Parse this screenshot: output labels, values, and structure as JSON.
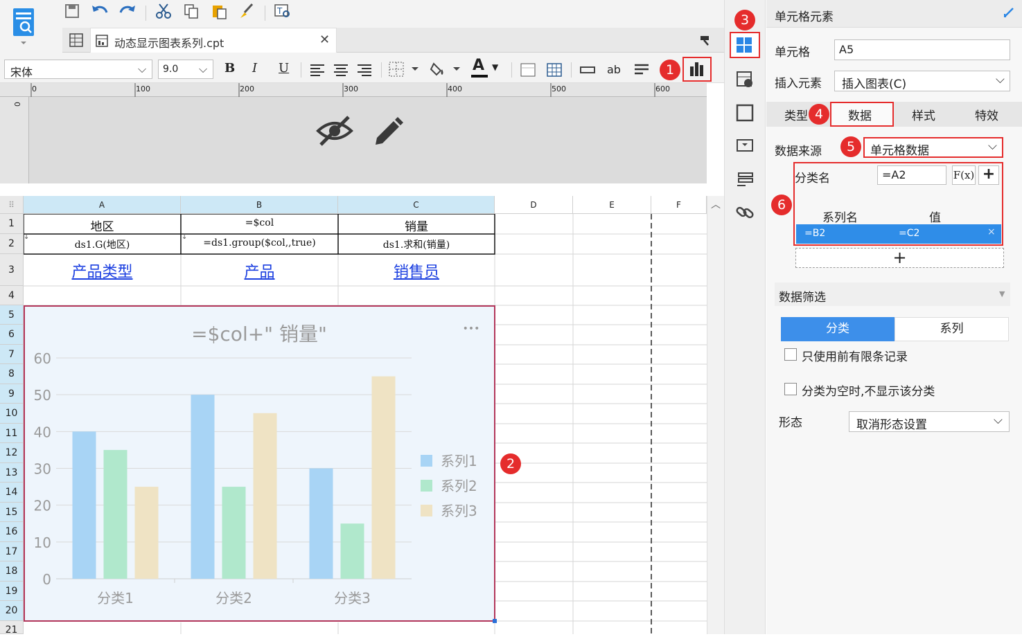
{
  "toolbar": {
    "filetab": "动态显示图表系列.cpt",
    "font_name": "宋体",
    "font_size": "9.0",
    "bold": "B",
    "italic": "I",
    "underline": "U",
    "font_color": "A",
    "ab": "ab",
    "font_options": [
      "宋体"
    ],
    "size_options": [
      "9.0"
    ]
  },
  "ruler": {
    "marks": [
      "0",
      "100",
      "200",
      "300",
      "400",
      "500",
      "600"
    ],
    "vmark": "0"
  },
  "sheet": {
    "columns": [
      "A",
      "B",
      "C",
      "D",
      "E",
      "F"
    ],
    "rows": [
      "1",
      "2",
      "3",
      "4",
      "5",
      "6",
      "7",
      "8",
      "9",
      "10",
      "11",
      "12",
      "13",
      "14",
      "15",
      "16",
      "17",
      "18",
      "19",
      "20",
      "21"
    ],
    "r1": {
      "a": "地区",
      "b": "=$col",
      "c": "销量"
    },
    "r2": {
      "a": "ds1.G(地区)",
      "b": "=ds1.group($col,,true)",
      "c": "ds1.求和(销量)"
    },
    "r3": {
      "a": "产品类型",
      "b": "产品",
      "c": "销售员"
    }
  },
  "chart_data": {
    "type": "bar",
    "title": "=$col+\" 销量\"",
    "categories": [
      "分类1",
      "分类2",
      "分类3"
    ],
    "series": [
      {
        "name": "系列1",
        "values": [
          40,
          50,
          30
        ],
        "color": "#a8d4f5"
      },
      {
        "name": "系列2",
        "values": [
          35,
          25,
          15
        ],
        "color": "#b0e8cc"
      },
      {
        "name": "系列3",
        "values": [
          25,
          45,
          55
        ],
        "color": "#efe3c4"
      }
    ],
    "yticks": [
      "0",
      "10",
      "20",
      "30",
      "40",
      "50",
      "60"
    ],
    "ylim": [
      0,
      60
    ],
    "legend": "right",
    "more": "•••"
  },
  "callouts": [
    "1",
    "2",
    "3",
    "4",
    "5",
    "6"
  ],
  "panel": {
    "title": "单元格元素",
    "cell_label": "单元格",
    "cell_value": "A5",
    "insert_label": "插入元素",
    "insert_value": "插入图表(C)",
    "tabs": [
      "类型",
      "数据",
      "样式",
      "特效"
    ],
    "datasource_label": "数据来源",
    "datasource_value": "单元格数据",
    "category_label": "分类名",
    "category_value": "=A2",
    "fx": "F(x)",
    "plus": "+",
    "series_header": "系列名",
    "value_header": "值",
    "series_row_name": "=B2",
    "series_row_value": "=C2",
    "remove": "×",
    "add_plus": "+",
    "filter_title": "数据筛选",
    "filter_tabs": [
      "分类",
      "系列"
    ],
    "check1": "只使用前有限条记录",
    "check2": "分类为空时,不显示该分类",
    "form_label": "形态",
    "form_value": "取消形态设置"
  },
  "colors": {
    "accent": "#3d8fea",
    "callout": "#e52c2c",
    "selected": "#2f8de8"
  }
}
